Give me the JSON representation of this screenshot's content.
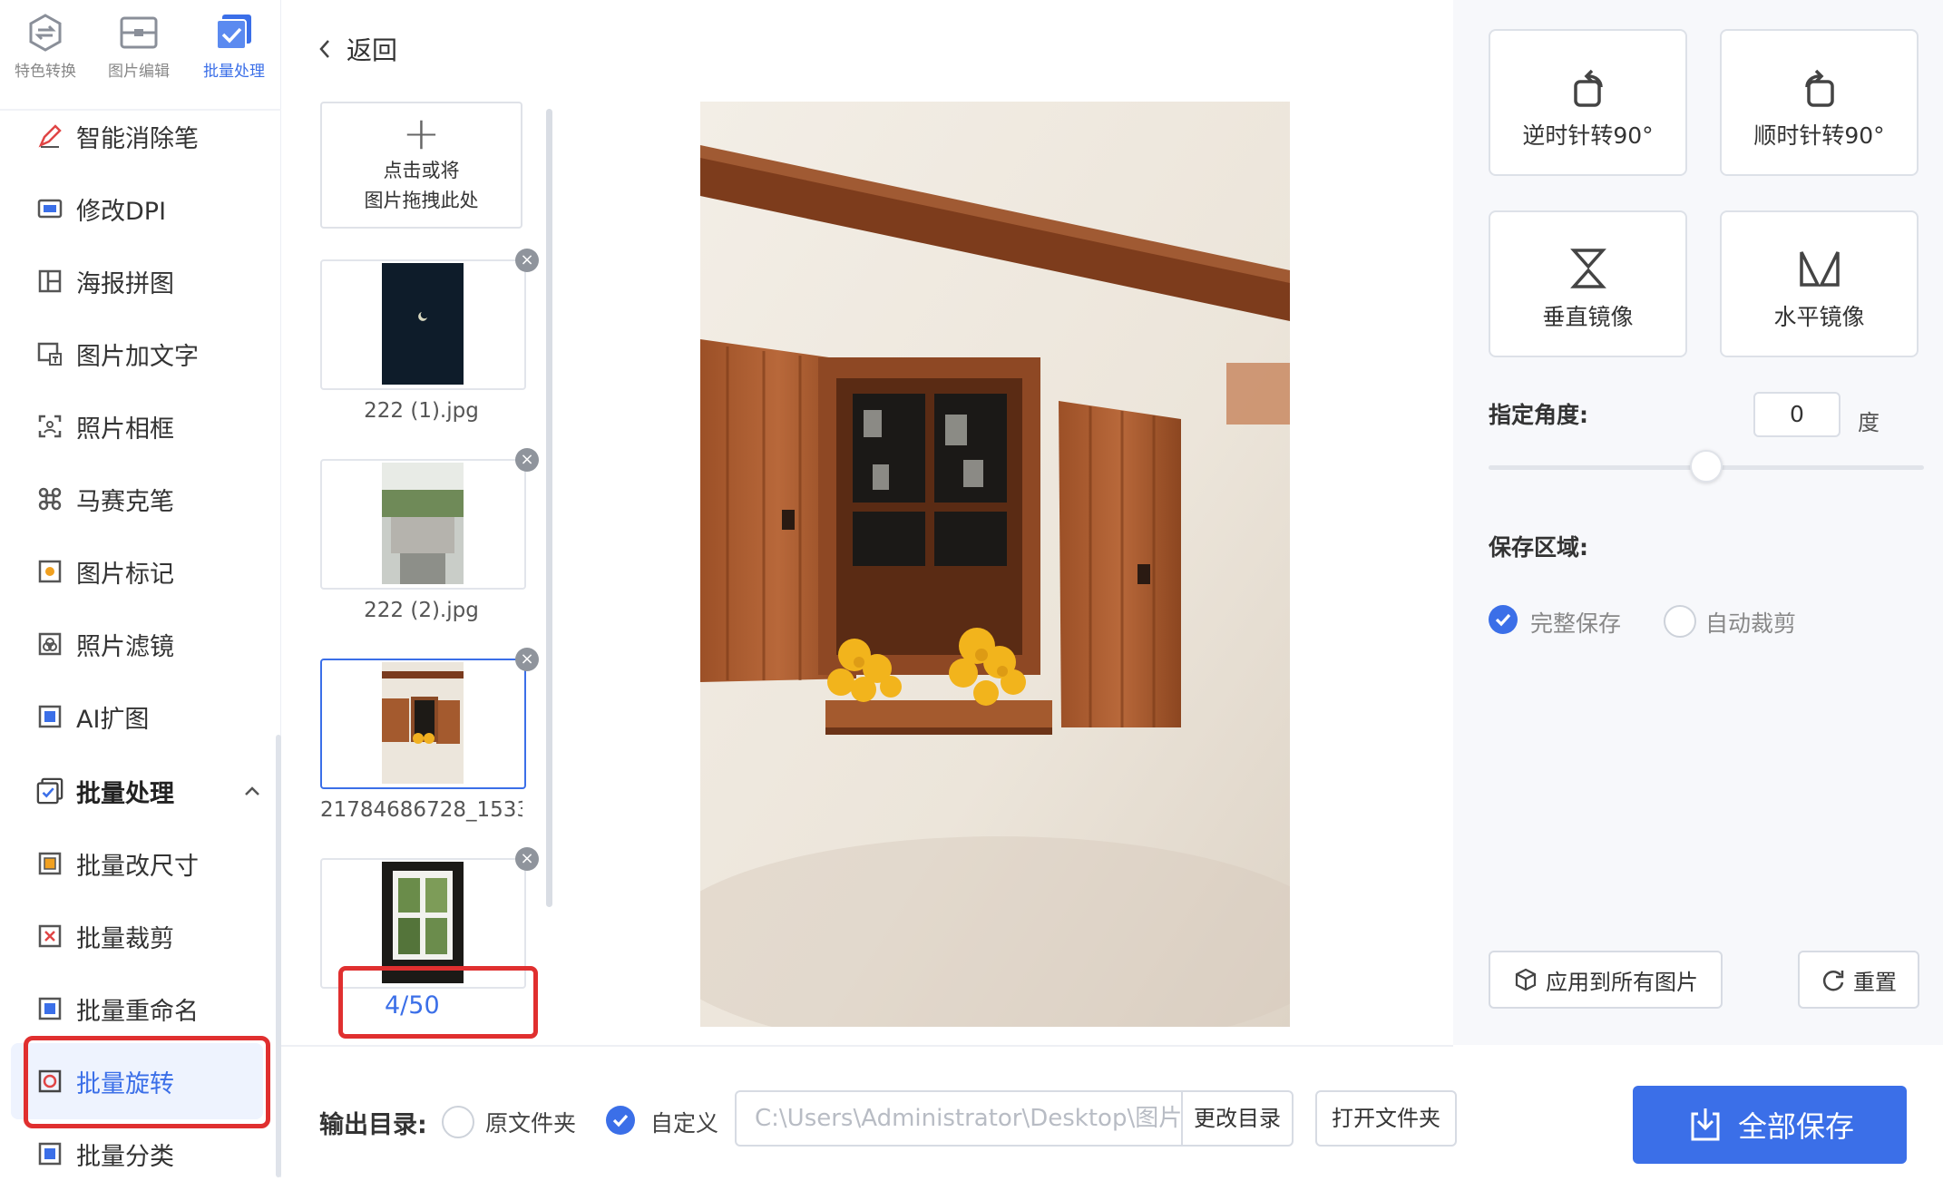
{
  "top_tabs": [
    {
      "label": "特色转换",
      "icon": "convert-icon"
    },
    {
      "label": "图片编辑",
      "icon": "edit-image-icon"
    },
    {
      "label": "批量处理",
      "icon": "batch-check-icon"
    }
  ],
  "sidebar": {
    "items": [
      {
        "label": "智能消除笔",
        "icon": "eraser-pen-icon"
      },
      {
        "label": "修改DPI",
        "icon": "dpi-icon"
      },
      {
        "label": "海报拼图",
        "icon": "collage-icon"
      },
      {
        "label": "图片加文字",
        "icon": "add-text-icon"
      },
      {
        "label": "照片相框",
        "icon": "photo-frame-icon"
      },
      {
        "label": "马赛克笔",
        "icon": "mosaic-icon"
      },
      {
        "label": "图片标记",
        "icon": "mark-icon"
      },
      {
        "label": "照片滤镜",
        "icon": "filter-icon"
      },
      {
        "label": "AI扩图",
        "icon": "ai-expand-icon"
      },
      {
        "label": "批量处理",
        "icon": "batch-check-icon"
      },
      {
        "label": "批量改尺寸",
        "icon": "resize-icon"
      },
      {
        "label": "批量裁剪",
        "icon": "crop-icon"
      },
      {
        "label": "批量重命名",
        "icon": "rename-icon"
      },
      {
        "label": "批量旋转",
        "icon": "rotate-icon"
      },
      {
        "label": "批量分类",
        "icon": "classify-icon"
      }
    ]
  },
  "back_label": "返回",
  "add_box": {
    "line1": "点击或将",
    "line2": "图片拖拽此处"
  },
  "thumbnails": [
    {
      "filename": "222 (1).jpg"
    },
    {
      "filename": "222 (2).jpg"
    },
    {
      "filename": "21784686728_1533..."
    },
    {
      "filename": ""
    }
  ],
  "counter": "4/50",
  "tools": {
    "rotate_ccw": "逆时针转90°",
    "rotate_cw": "顺时针转90°",
    "flip_vertical": "垂直镜像",
    "flip_horizontal": "水平镜像"
  },
  "angle": {
    "label": "指定角度:",
    "value": "0",
    "unit": "度",
    "slider_fraction": 0.5
  },
  "save_area": {
    "label": "保存区域:",
    "options": [
      {
        "label": "完整保存",
        "selected": true
      },
      {
        "label": "自动裁剪",
        "selected": false
      }
    ]
  },
  "apply_all_label": "应用到所有图片",
  "reset_label": "重置",
  "output": {
    "label": "输出目录:",
    "options": [
      {
        "label": "原文件夹",
        "selected": false
      },
      {
        "label": "自定义",
        "selected": true
      }
    ],
    "path": "C:\\Users\\Administrator\\Desktop\\图片",
    "change_dir_label": "更改目录",
    "open_folder_label": "打开文件夹"
  },
  "save_all_label": "全部保存",
  "colors": {
    "accent": "#3b6fe8",
    "highlight_red": "#e02f2f"
  }
}
